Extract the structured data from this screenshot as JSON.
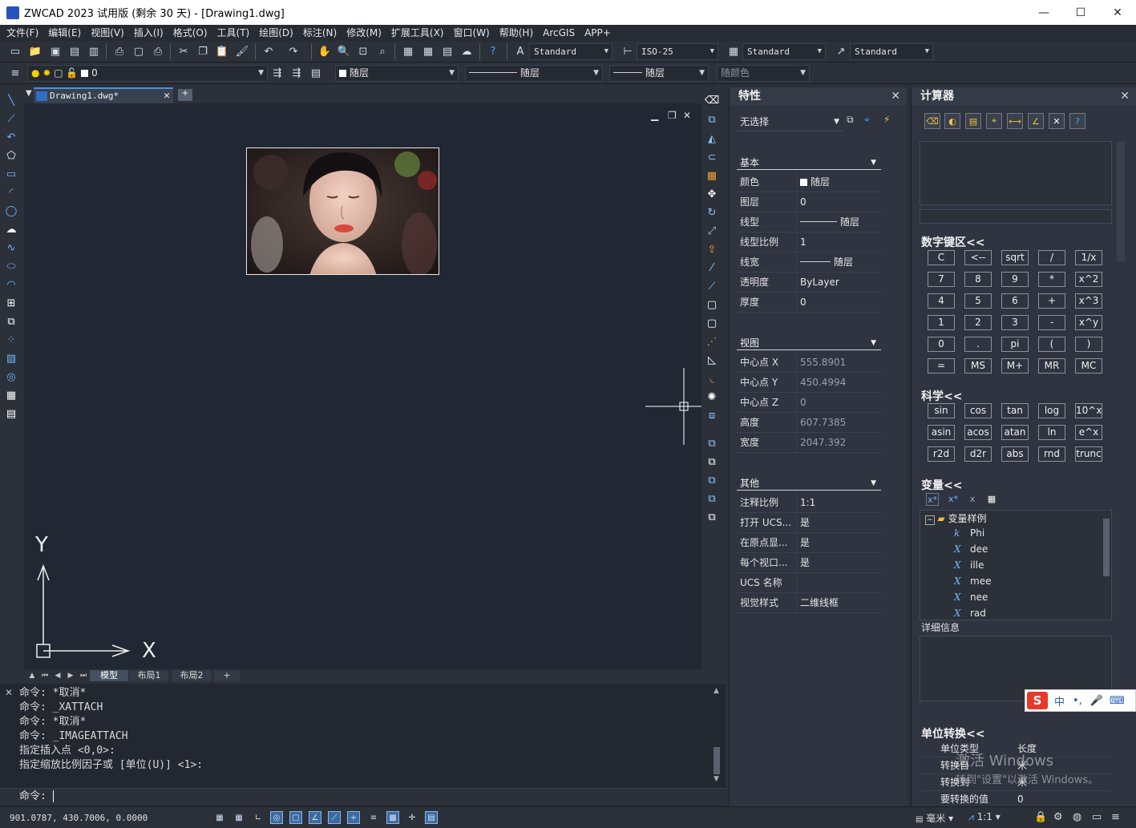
{
  "window": {
    "title": "ZWCAD 2023 试用版 (剩余 30 天) - [Drawing1.dwg]",
    "minimize": "—",
    "maximize": "☐",
    "close": "✕"
  },
  "menu": [
    "文件(F)",
    "编辑(E)",
    "视图(V)",
    "插入(I)",
    "格式(O)",
    "工具(T)",
    "绘图(D)",
    "标注(N)",
    "修改(M)",
    "扩展工具(X)",
    "窗口(W)",
    "帮助(H)",
    "ArcGIS",
    "APP+"
  ],
  "toolbar": {
    "text_style": "Standard",
    "dim_style": "ISO-25",
    "table_style": "Standard",
    "multileader_style": "Standard",
    "layer": "0",
    "color": "随层",
    "linetype": "随层",
    "lineweight": "随层",
    "plot_style": "随颜色"
  },
  "document": {
    "tab_label": "Drawing1.dwg*",
    "tab_close": "✕"
  },
  "canvas": {
    "y_axis_label": "Y",
    "x_axis_label": "X",
    "background_color": "#212833"
  },
  "layout_tabs": [
    "模型",
    "布局1",
    "布局2",
    "+"
  ],
  "command": {
    "history": [
      "命令: *取消*",
      "命令: _XATTACH",
      "命令: *取消*",
      "命令: _IMAGEATTACH",
      "指定插入点 <0,0>:",
      "指定缩放比例因子或 [单位(U)] <1>:"
    ],
    "prompt": "命令:"
  },
  "status": {
    "coords": "901.0787, 430.7006, 0.0000",
    "units": "毫米",
    "scale": "1:1"
  },
  "properties": {
    "title": "特性",
    "selection": "无选择",
    "sections": {
      "basic": {
        "title": "基本",
        "rows": [
          {
            "key": "颜色",
            "value": "随层"
          },
          {
            "key": "图层",
            "value": "0"
          },
          {
            "key": "线型",
            "value": "随层"
          },
          {
            "key": "线型比例",
            "value": "1"
          },
          {
            "key": "线宽",
            "value": "随层"
          },
          {
            "key": "透明度",
            "value": "ByLayer"
          },
          {
            "key": "厚度",
            "value": "0"
          }
        ]
      },
      "view": {
        "title": "视图",
        "rows": [
          {
            "key": "中心点 X",
            "value": "555.8901"
          },
          {
            "key": "中心点 Y",
            "value": "450.4994"
          },
          {
            "key": "中心点 Z",
            "value": "0"
          },
          {
            "key": "高度",
            "value": "607.7385"
          },
          {
            "key": "宽度",
            "value": "2047.392"
          }
        ]
      },
      "misc": {
        "title": "其他",
        "rows": [
          {
            "key": "注释比例",
            "value": "1:1"
          },
          {
            "key": "打开 UCS...",
            "value": "是"
          },
          {
            "key": "在原点显...",
            "value": "是"
          },
          {
            "key": "每个视口...",
            "value": "是"
          },
          {
            "key": "UCS 名称",
            "value": ""
          },
          {
            "key": "视觉样式",
            "value": "二维线框"
          }
        ]
      }
    }
  },
  "calculator": {
    "title": "计算器",
    "numpad_title": "数字键区<<",
    "numpad": [
      [
        "C",
        "<--",
        "sqrt",
        "/",
        "1/x"
      ],
      [
        "7",
        "8",
        "9",
        "*",
        "x^2"
      ],
      [
        "4",
        "5",
        "6",
        "+",
        "x^3"
      ],
      [
        "1",
        "2",
        "3",
        "-",
        "x^y"
      ],
      [
        "0",
        ".",
        "pi",
        "(",
        ")"
      ],
      [
        "=",
        "MS",
        "M+",
        "MR",
        "MC"
      ]
    ],
    "sci_title": "科学<<",
    "sci": [
      [
        "sin",
        "cos",
        "tan",
        "log",
        "10^x"
      ],
      [
        "asin",
        "acos",
        "atan",
        "ln",
        "e^x"
      ],
      [
        "r2d",
        "d2r",
        "abs",
        "rnd",
        "trunc"
      ]
    ],
    "vars_title": "变量<<",
    "var_folder": "变量样例",
    "variables": [
      {
        "icon": "k",
        "name": "Phi"
      },
      {
        "icon": "X",
        "name": "dee"
      },
      {
        "icon": "X",
        "name": "ille"
      },
      {
        "icon": "X",
        "name": "mee"
      },
      {
        "icon": "X",
        "name": "nee"
      },
      {
        "icon": "X",
        "name": "rad"
      }
    ],
    "details_label": "详细信息",
    "units_title": "单位转换<<",
    "units_rows": [
      {
        "key": "单位类型",
        "value": "长度"
      },
      {
        "key": "转换自",
        "value": "米"
      },
      {
        "key": "转换到",
        "value": "米"
      },
      {
        "key": "要转换的值",
        "value": "0"
      }
    ]
  },
  "overlay": {
    "activate_line1": "激活 Windows",
    "activate_line2": "转到\"设置\"以激活 Windows。",
    "ime_mode": "中"
  }
}
